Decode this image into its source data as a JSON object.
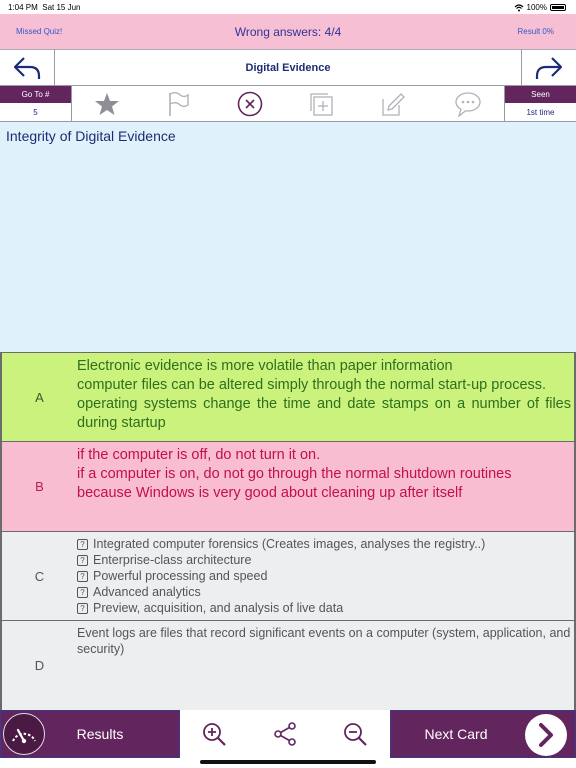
{
  "status_bar": {
    "time": "1:04 PM",
    "date": "Sat 15 Jun",
    "battery": "100%"
  },
  "header": {
    "missed_quiz": "Missed Quiz!",
    "wrong_answers": "Wrong answers: 4/4",
    "result": "Result 0%"
  },
  "nav": {
    "title": "Digital Evidence"
  },
  "toolbar": {
    "goto_label": "Go To #",
    "goto_value": "5",
    "seen_label": "Seen",
    "seen_value": "1st time",
    "icons": [
      "star-icon",
      "flag-icon",
      "close-circle-icon",
      "add-card-icon",
      "edit-icon",
      "comment-icon"
    ]
  },
  "question": {
    "text": "Integrity of Digital Evidence"
  },
  "answers": {
    "a": {
      "letter": "A",
      "lines": [
        "Electronic evidence is more volatile than paper information",
        "computer files can be altered simply through the normal start-up process.",
        "operating systems change the time and date stamps on a number of files during startup"
      ]
    },
    "b": {
      "letter": "B",
      "lines": [
        "if the computer is off, do not turn it on.",
        "if a computer is on, do not go through the normal shutdown routines",
        "because Windows is very good about cleaning up after itself"
      ]
    },
    "c": {
      "letter": "C",
      "marker": "?",
      "lines": [
        "Integrated computer forensics (Creates images, analyses the registry..)",
        "Enterprise-class architecture",
        "Powerful processing and speed",
        "Advanced analytics",
        "Preview, acquisition, and analysis of live data"
      ]
    },
    "d": {
      "letter": "D",
      "lines": [
        "Event logs are files that record significant events on a computer (system, application, and security)"
      ]
    }
  },
  "bottom": {
    "results_label": "Results",
    "next_label": "Next Card"
  },
  "colors": {
    "header_pink": "#f7bfd3",
    "accent_purple": "#63255e",
    "answer_green": "#cbf27d",
    "answer_pink": "#f8bdd0",
    "question_bg": "#dff1fb"
  }
}
